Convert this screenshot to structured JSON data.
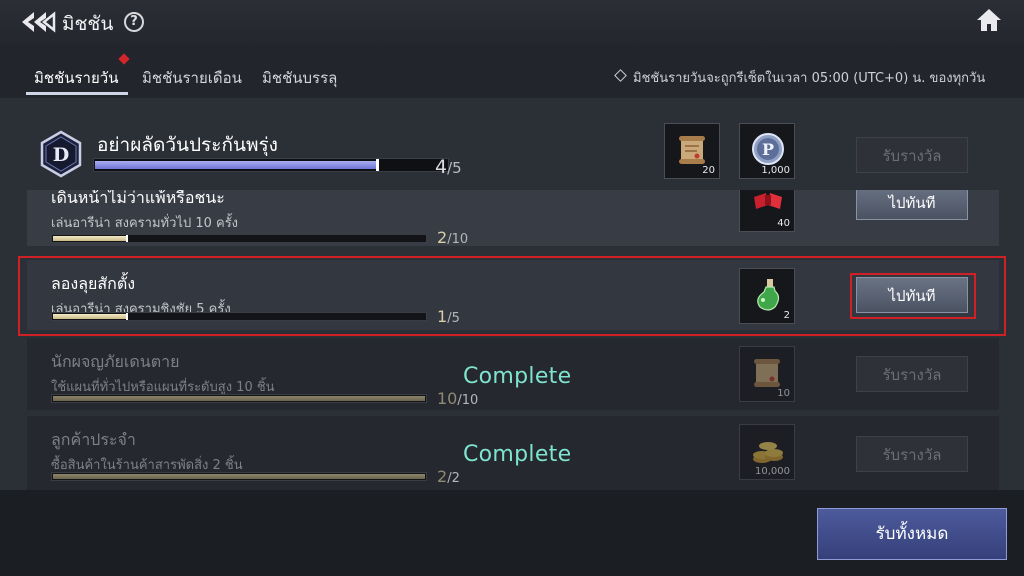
{
  "header": {
    "title": "มิชชัน",
    "help": "?"
  },
  "tabs": [
    {
      "label": "มิชชันรายวัน",
      "active": true
    },
    {
      "label": "มิชชันรายเดือน",
      "active": false
    },
    {
      "label": "มิชชันบรรลุ",
      "active": false
    }
  ],
  "reset_note": "มิชชันรายวันจะถูกรีเซ็ตในเวลา 05:00 (UTC+0) น. ของทุกวัน",
  "summary": {
    "badge": "D",
    "title": "อย่าผลัดวันประกันพรุ่ง",
    "progress_current": "4",
    "progress_total": "/5",
    "progress_fraction": 0.8,
    "rewards": [
      {
        "icon": "scroll-icon",
        "qty": "20"
      },
      {
        "icon": "p-coin-icon",
        "qty": "1,000"
      }
    ],
    "claim_label": "รับรางวัล"
  },
  "missions": [
    {
      "name": "เดินหน้าไม่ว่าแพ้หรือชนะ",
      "desc": "เล่นอารีน่า สงครามทั่วไป 10 ครั้ง",
      "current": "2",
      "total": "/10",
      "fraction": 0.2,
      "reward_icon": "ribbon-icon",
      "reward_qty": "40",
      "button": "ไปทันที",
      "status": ""
    },
    {
      "name": "ลองลุยสักตั้ง",
      "desc": "เล่นอารีน่า สงครามชิงชัย 5 ครั้ง",
      "current": "1",
      "total": "/5",
      "fraction": 0.2,
      "reward_icon": "potion-icon",
      "reward_qty": "2",
      "button": "ไปทันที",
      "status": ""
    },
    {
      "name": "นักผจญภัยเดนตาย",
      "desc": "ใช้แผนที่ทั่วไปหรือแผนที่ระดับสูง 10 ชิ้น",
      "current": "10",
      "total": "/10",
      "fraction": 1,
      "reward_icon": "scroll-icon",
      "reward_qty": "10",
      "button": "รับรางวัล",
      "status": "Complete"
    },
    {
      "name": "ลูกค้าประจำ",
      "desc": "ซื้อสินค้าในร้านค้าสารพัดสิ่ง 2 ชิ้น",
      "current": "2",
      "total": "/2",
      "fraction": 1,
      "reward_icon": "gold-coins-icon",
      "reward_qty": "10,000",
      "button": "รับรางวัล",
      "status": "Complete"
    }
  ],
  "footer": {
    "claim_all": "รับทั้งหมด"
  },
  "colors": {
    "highlight": "#d12025",
    "complete": "#7ee4d0",
    "progress_header": "#8a8fe6"
  }
}
